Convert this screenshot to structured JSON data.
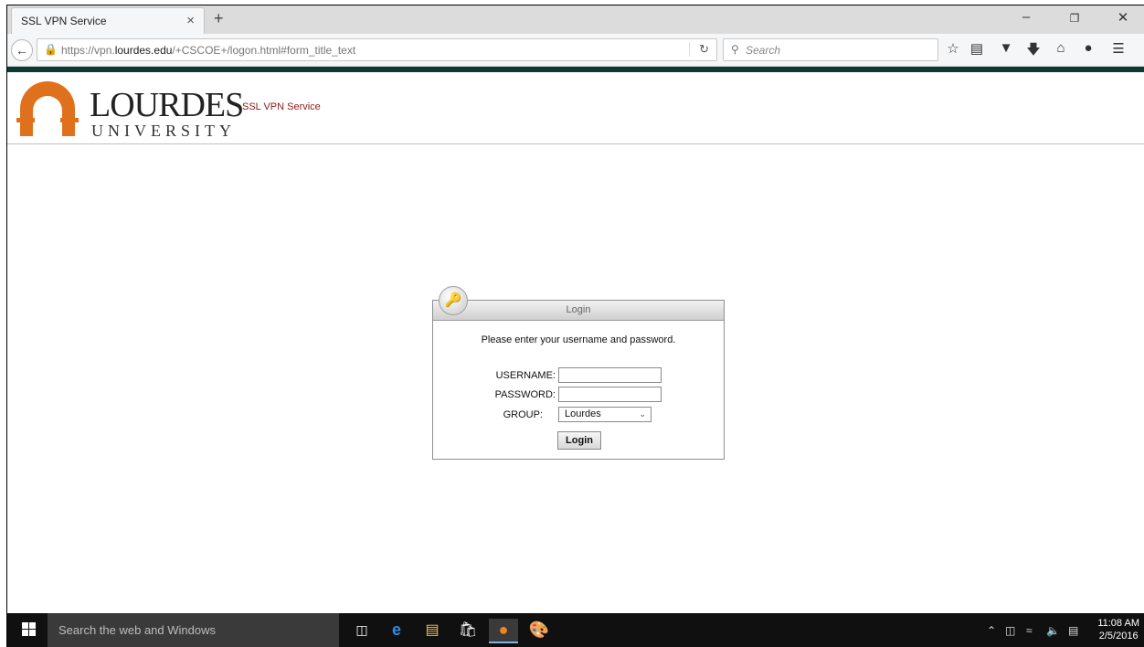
{
  "browser": {
    "tab_title": "SSL VPN Service",
    "tab_close": "×",
    "new_tab": "+",
    "url_prefix": "https://vpn.",
    "url_domain": "lourdes.edu",
    "url_path": "/+CSCOE+/logon.html#form_title_text",
    "search_placeholder": "Search",
    "window_buttons": [
      "–",
      "❐",
      "✕"
    ],
    "toolbar_icons": [
      "star-icon",
      "bookmarks-icon",
      "pocket-icon",
      "downloads-icon",
      "home-icon",
      "chat-icon",
      "menu-icon"
    ]
  },
  "header": {
    "logo_main": "LOURDES",
    "logo_sub": "UNIVERSITY",
    "service_name": "SSL VPN Service",
    "brand_color": "#e0711c",
    "stripe_color": "#0c3a32"
  },
  "login": {
    "title": "Login",
    "prompt": "Please enter your username and password.",
    "username_label": "USERNAME:",
    "username_value": "",
    "password_label": "PASSWORD:",
    "password_value": "",
    "group_label": "GROUP:",
    "group_value": "Lourdes",
    "submit_label": "Login"
  },
  "taskbar": {
    "search_placeholder": "Search the web and Windows",
    "apps": [
      "task-view-icon",
      "edge-icon",
      "file-explorer-icon",
      "store-icon",
      "firefox-icon",
      "paint-icon"
    ],
    "time": "11:08 AM",
    "date": "2/5/2016"
  }
}
